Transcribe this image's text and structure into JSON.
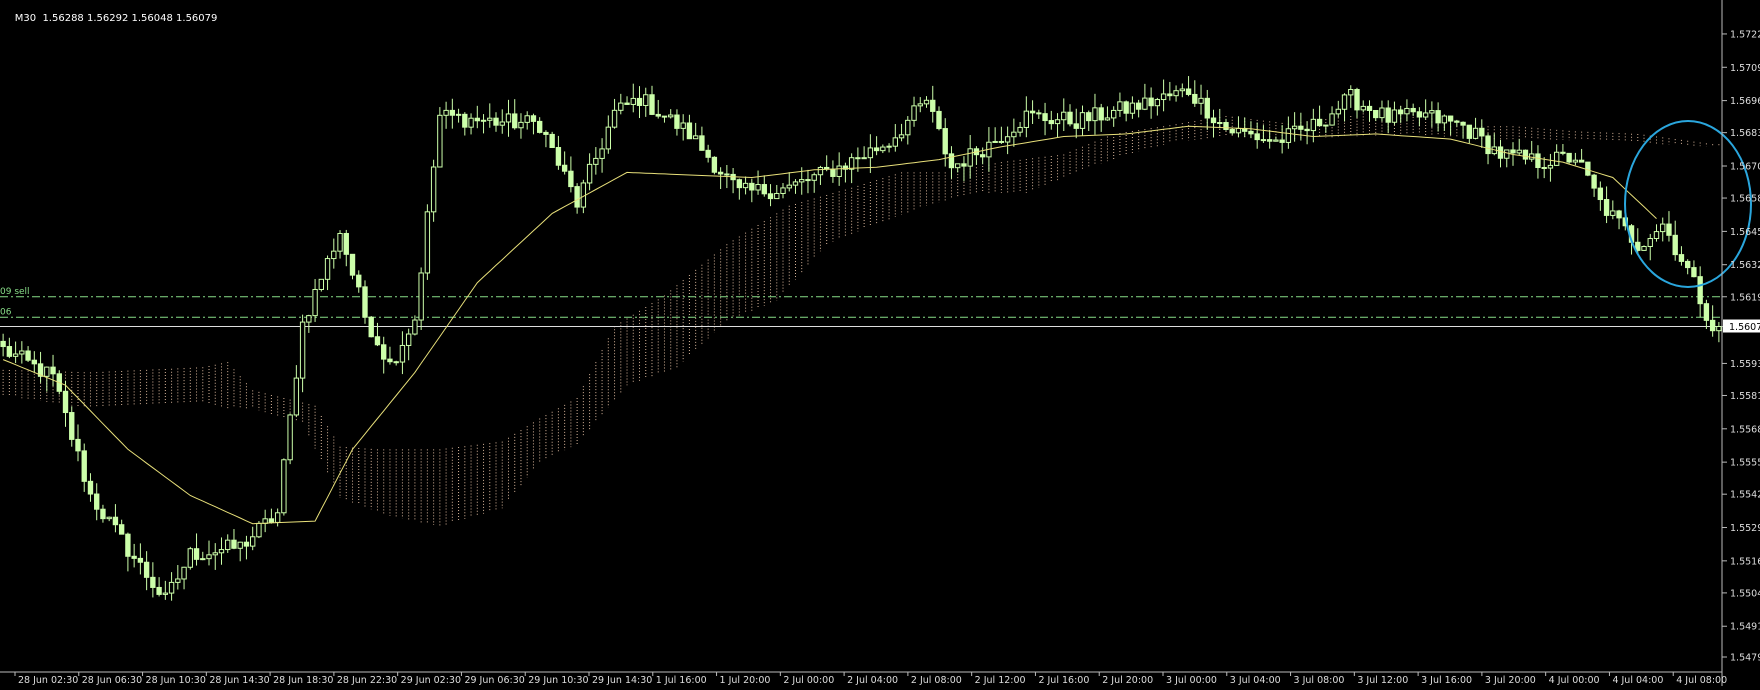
{
  "header": {
    "symbol_tf": "M30",
    "ohlc": "1.56288 1.56292 1.56048 1.56079"
  },
  "order_labels": [
    "09 sell",
    "06"
  ],
  "colors": {
    "background": "#000000",
    "candle": "#ccffaa",
    "ma": "#e8e07a",
    "cloud": "#d8b59a",
    "level": "#88dd88",
    "price_line": "#dddddd",
    "circle": "#2aa6dd",
    "axis_text": "#dddddd"
  },
  "chart_data": {
    "type": "candlestick",
    "y_ticks": [
      "1.57220",
      "1.57090",
      "1.56960",
      "1.56835",
      "1.56705",
      "1.56580",
      "1.56450",
      "1.56320",
      "1.56195",
      "1.56079",
      "1.55935",
      "1.55810",
      "1.55680",
      "1.55550",
      "1.55425",
      "1.55295",
      "1.55165",
      "1.55040",
      "1.54910",
      "1.54790"
    ],
    "ylim": [
      1.5479,
      1.5729
    ],
    "x_labels": [
      "28 Jun 02:30",
      "28 Jun 06:30",
      "28 Jun 10:30",
      "28 Jun 14:30",
      "28 Jun 18:30",
      "28 Jun 22:30",
      "29 Jun 02:30",
      "29 Jun 06:30",
      "29 Jun 10:30",
      "29 Jun 14:30",
      "1 Jul 16:00",
      "1 Jul 20:00",
      "2 Jul 00:00",
      "2 Jul 04:00",
      "2 Jul 08:00",
      "2 Jul 12:00",
      "2 Jul 16:00",
      "2 Jul 20:00",
      "3 Jul 00:00",
      "3 Jul 04:00",
      "3 Jul 08:00",
      "3 Jul 12:00",
      "3 Jul 16:00",
      "3 Jul 20:00",
      "4 Jul 00:00",
      "4 Jul 04:00",
      "4 Jul 08:00"
    ],
    "current_price": "1.56079",
    "current_price_value": 1.56079,
    "levels": [
      1.56195,
      1.56115
    ],
    "anchors": [
      [
        0,
        1.5599
      ],
      [
        8,
        1.5588
      ],
      [
        14,
        1.5542
      ],
      [
        20,
        1.5521
      ],
      [
        26,
        1.5501
      ],
      [
        30,
        1.5519
      ],
      [
        38,
        1.5522
      ],
      [
        44,
        1.5535
      ],
      [
        48,
        1.5609
      ],
      [
        54,
        1.5645
      ],
      [
        58,
        1.5612
      ],
      [
        62,
        1.5593
      ],
      [
        66,
        1.5611
      ],
      [
        70,
        1.569
      ],
      [
        78,
        1.5688
      ],
      [
        86,
        1.5687
      ],
      [
        92,
        1.5656
      ],
      [
        98,
        1.5691
      ],
      [
        102,
        1.5697
      ],
      [
        110,
        1.5683
      ],
      [
        118,
        1.566
      ],
      [
        126,
        1.5662
      ],
      [
        134,
        1.567
      ],
      [
        142,
        1.568
      ],
      [
        148,
        1.5696
      ],
      [
        152,
        1.567
      ],
      [
        158,
        1.5679
      ],
      [
        164,
        1.569
      ],
      [
        172,
        1.5688
      ],
      [
        182,
        1.5694
      ],
      [
        190,
        1.57
      ],
      [
        196,
        1.5685
      ],
      [
        204,
        1.568
      ],
      [
        210,
        1.5686
      ],
      [
        216,
        1.5697
      ],
      [
        222,
        1.5689
      ],
      [
        228,
        1.569
      ],
      [
        234,
        1.5686
      ],
      [
        240,
        1.5675
      ],
      [
        246,
        1.5672
      ],
      [
        252,
        1.5674
      ],
      [
        256,
        1.5656
      ],
      [
        262,
        1.564
      ],
      [
        266,
        1.5648
      ],
      [
        270,
        1.563
      ],
      [
        274,
        1.5608
      ]
    ],
    "ma_anchors": [
      [
        0,
        1.5595
      ],
      [
        10,
        1.5585
      ],
      [
        20,
        1.556
      ],
      [
        30,
        1.5542
      ],
      [
        40,
        1.5531
      ],
      [
        50,
        1.5532
      ],
      [
        56,
        1.556
      ],
      [
        66,
        1.559
      ],
      [
        76,
        1.5625
      ],
      [
        88,
        1.5652
      ],
      [
        100,
        1.5668
      ],
      [
        110,
        1.5667
      ],
      [
        120,
        1.5666
      ],
      [
        130,
        1.5669
      ],
      [
        140,
        1.567
      ],
      [
        150,
        1.5673
      ],
      [
        160,
        1.5678
      ],
      [
        170,
        1.5682
      ],
      [
        180,
        1.5683
      ],
      [
        190,
        1.5686
      ],
      [
        200,
        1.5685
      ],
      [
        210,
        1.5682
      ],
      [
        220,
        1.5683
      ],
      [
        232,
        1.5681
      ],
      [
        242,
        1.5675
      ],
      [
        250,
        1.5672
      ],
      [
        258,
        1.5666
      ],
      [
        265,
        1.565
      ]
    ],
    "cloud_upper": [
      [
        0,
        1.5591
      ],
      [
        14,
        1.559
      ],
      [
        32,
        1.5592
      ],
      [
        36,
        1.5594
      ],
      [
        40,
        1.5583
      ],
      [
        50,
        1.5577
      ],
      [
        54,
        1.5561
      ],
      [
        60,
        1.556
      ],
      [
        70,
        1.556
      ],
      [
        80,
        1.5563
      ],
      [
        86,
        1.5572
      ],
      [
        92,
        1.558
      ],
      [
        98,
        1.5608
      ],
      [
        106,
        1.562
      ],
      [
        116,
        1.564
      ],
      [
        126,
        1.5655
      ],
      [
        136,
        1.5662
      ],
      [
        144,
        1.5668
      ],
      [
        152,
        1.5668
      ],
      [
        160,
        1.5672
      ],
      [
        170,
        1.5675
      ],
      [
        178,
        1.5683
      ],
      [
        186,
        1.5686
      ],
      [
        196,
        1.569
      ],
      [
        206,
        1.5687
      ],
      [
        216,
        1.569
      ],
      [
        224,
        1.5694
      ],
      [
        232,
        1.5686
      ],
      [
        242,
        1.5686
      ],
      [
        252,
        1.5684
      ],
      [
        262,
        1.5683
      ],
      [
        274,
        1.5679
      ]
    ],
    "cloud_lower": [
      [
        0,
        1.5581
      ],
      [
        14,
        1.5576
      ],
      [
        32,
        1.5578
      ],
      [
        36,
        1.5576
      ],
      [
        40,
        1.5576
      ],
      [
        48,
        1.557
      ],
      [
        54,
        1.5541
      ],
      [
        62,
        1.5534
      ],
      [
        70,
        1.553
      ],
      [
        80,
        1.5537
      ],
      [
        86,
        1.5555
      ],
      [
        92,
        1.5562
      ],
      [
        100,
        1.5585
      ],
      [
        108,
        1.5592
      ],
      [
        116,
        1.561
      ],
      [
        124,
        1.5618
      ],
      [
        132,
        1.564
      ],
      [
        140,
        1.5648
      ],
      [
        148,
        1.5655
      ],
      [
        156,
        1.566
      ],
      [
        164,
        1.566
      ],
      [
        172,
        1.5668
      ],
      [
        180,
        1.5675
      ],
      [
        188,
        1.568
      ],
      [
        196,
        1.5682
      ],
      [
        206,
        1.5681
      ],
      [
        216,
        1.5682
      ],
      [
        226,
        1.5683
      ],
      [
        236,
        1.5681
      ],
      [
        246,
        1.5681
      ],
      [
        258,
        1.568
      ],
      [
        274,
        1.5678
      ]
    ]
  }
}
